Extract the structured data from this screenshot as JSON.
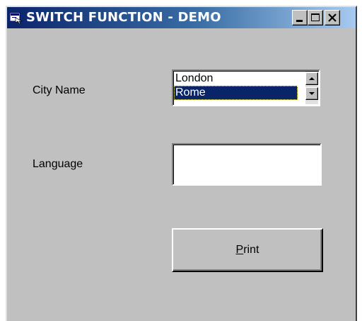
{
  "window": {
    "title": "SWITCH FUNCTION - DEMO",
    "icon": "form-icon",
    "controls": [
      "minimize-icon",
      "maximize-icon",
      "close-icon"
    ]
  },
  "form": {
    "city_label": "City Name",
    "language_label": "Language",
    "cities": [
      "London",
      "Rome"
    ],
    "selected_city": "Rome",
    "language_value": "",
    "print_button": {
      "access_key": "P",
      "rest": "rint"
    }
  },
  "colors": {
    "titlebar_start": "#0a246a",
    "titlebar_end": "#a6caf0",
    "face": "#c0c0c0",
    "selection": "#0a246a"
  }
}
